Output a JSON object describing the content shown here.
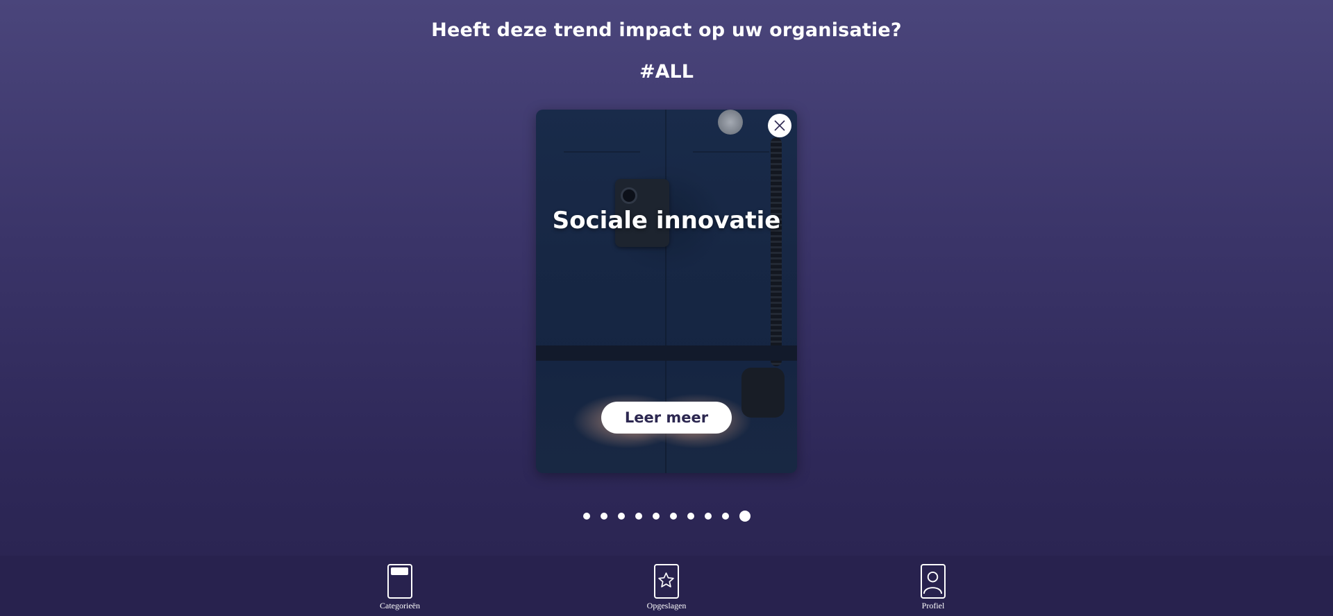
{
  "question": "Heeft deze trend impact op uw organisatie?",
  "tag": "#ALL",
  "card": {
    "title": "Sociale innovatie",
    "button_label": "Leer meer",
    "close_icon": "close-icon"
  },
  "carousel": {
    "total": 10,
    "active_index": 9
  },
  "nav": {
    "items": [
      {
        "label": "Categorieën",
        "icon": "categories-icon"
      },
      {
        "label": "Opgeslagen",
        "icon": "star-icon"
      },
      {
        "label": "Profiel",
        "icon": "profile-icon"
      }
    ]
  },
  "colors": {
    "background_top": "#4a457b",
    "background_bottom": "#29234f",
    "nav_background": "#28224e",
    "button_text": "#2c2750"
  }
}
